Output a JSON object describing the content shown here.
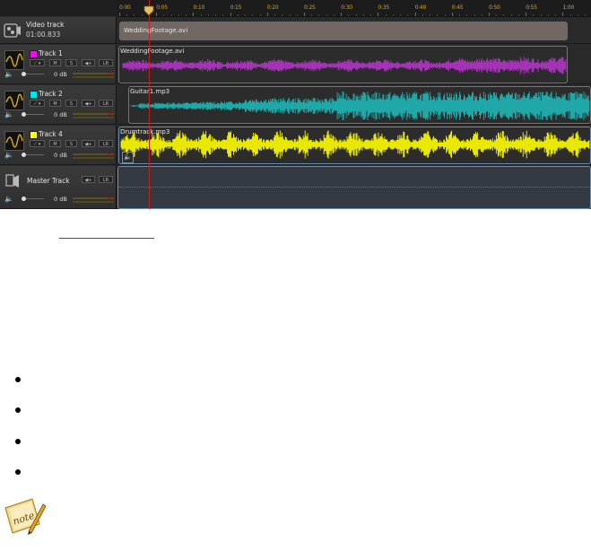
{
  "timeline": {
    "ticks": [
      "0:00",
      "0:05",
      "0:10",
      "0:15",
      "0:20",
      "0:25",
      "0:30",
      "0:35",
      "0:40",
      "0:45",
      "0:50",
      "0:55",
      "1:00"
    ]
  },
  "video_track": {
    "name": "Video track",
    "duration": "01:00.833",
    "clip_name": "WeddingFootage.avi"
  },
  "tracks": [
    {
      "name": "Track 1",
      "color": "#ff00ff",
      "wave_color": "#a335b5",
      "volume": "0 dB",
      "clip_name": "WeddingFootage.avi"
    },
    {
      "name": "Track 2",
      "color": "#00e5e5",
      "wave_color": "#20a7a7",
      "volume": "0 dB",
      "clip_name": "Guitar1.mp3"
    },
    {
      "name": "Track 4",
      "color": "#ffff00",
      "wave_color": "#e8e800",
      "volume": "0 dB",
      "clip_name": "Drumtrack.mp3"
    }
  ],
  "master": {
    "name": "Master Track",
    "volume": "0 dB"
  },
  "controls": {
    "mute": "M",
    "solo": "S",
    "rewind": "◀+",
    "lr": "LR"
  },
  "accents": {
    "playhead": "#c42020",
    "ruler_text": "#d8a224",
    "link": "#1f4fc4",
    "selection": "#6a8fb8"
  },
  "bullets_count": 4
}
